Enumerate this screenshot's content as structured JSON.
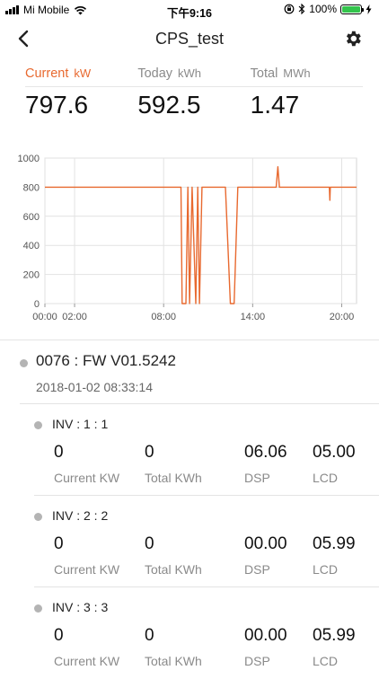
{
  "status": {
    "carrier": "Mi Mobile",
    "time": "下午9:16",
    "battery": "100%"
  },
  "nav": {
    "title": "CPS_test",
    "back_icon": "chevron-left-icon",
    "settings_icon": "gear-icon"
  },
  "summary": {
    "current_label": "Current",
    "current_unit": "kW",
    "current_value": "797.6",
    "today_label": "Today",
    "today_unit": "kWh",
    "today_value": "592.5",
    "total_label": "Total",
    "total_unit": "MWh",
    "total_value": "1.47",
    "active_color": "#e8692f"
  },
  "chart_data": {
    "type": "line",
    "xlabel": "",
    "ylabel": "",
    "ylim": [
      0,
      1000
    ],
    "xlim": [
      "00:00",
      "21:00"
    ],
    "x_ticks": [
      "00:00",
      "02:00",
      "08:00",
      "14:00",
      "20:00"
    ],
    "y_ticks": [
      "0",
      "200",
      "400",
      "600",
      "800",
      "1000"
    ],
    "grid": true,
    "series": [
      {
        "color": "#e8692f",
        "x": [
          "00:00",
          "09:10",
          "09:15",
          "09:30",
          "09:38",
          "09:45",
          "09:55",
          "10:10",
          "10:18",
          "10:25",
          "10:35",
          "10:45",
          "12:10",
          "12:30",
          "12:45",
          "13:00",
          "15:35",
          "15:42",
          "15:48",
          "19:10",
          "19:12",
          "19:14",
          "21:00"
        ],
        "values": [
          800,
          800,
          0,
          0,
          800,
          0,
          800,
          0,
          800,
          0,
          800,
          800,
          800,
          0,
          0,
          800,
          800,
          940,
          800,
          800,
          710,
          800,
          800
        ]
      }
    ]
  },
  "device": {
    "name": "0076 : FW V01.5242",
    "timestamp": "2018-01-02 08:33:14",
    "inverters": [
      {
        "name": "INV : 1 : 1",
        "current_value": "0",
        "current_label": "Current  KW",
        "total_value": "0",
        "total_label": "Total  KWh",
        "dsp_value": "06.06",
        "dsp_label": "DSP",
        "lcd_value": "05.00",
        "lcd_label": "LCD"
      },
      {
        "name": "INV : 2 : 2",
        "current_value": "0",
        "current_label": "Current  KW",
        "total_value": "0",
        "total_label": "Total  KWh",
        "dsp_value": "00.00",
        "dsp_label": "DSP",
        "lcd_value": "05.99",
        "lcd_label": "LCD"
      },
      {
        "name": "INV : 3 : 3",
        "current_value": "0",
        "current_label": "Current  KW",
        "total_value": "0",
        "total_label": "Total  KWh",
        "dsp_value": "00.00",
        "dsp_label": "DSP",
        "lcd_value": "05.99",
        "lcd_label": "LCD"
      }
    ]
  }
}
